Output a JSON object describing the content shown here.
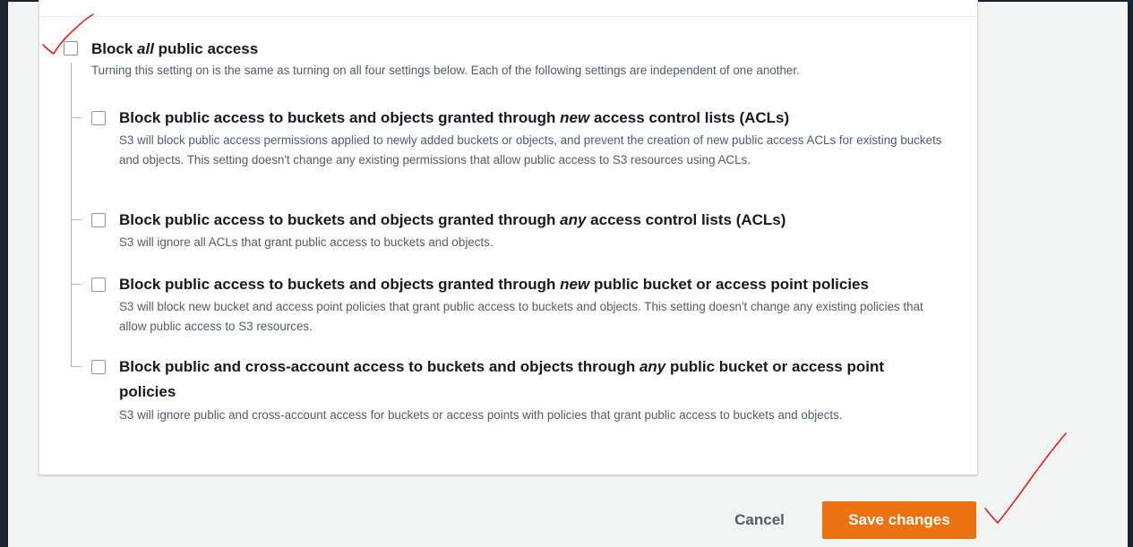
{
  "block_all": {
    "title_before": "Block ",
    "title_em": "all",
    "title_after": " public access",
    "description": "Turning this setting on is the same as turning on all four settings below. Each of the following settings are independent of one another.",
    "checked": false
  },
  "settings": [
    {
      "title_before": "Block public access to buckets and objects granted through ",
      "title_em": "new",
      "title_after": " access control lists (ACLs)",
      "description": "S3 will block public access permissions applied to newly added buckets or objects, and prevent the creation of new public access ACLs for existing buckets and objects. This setting doesn't change any existing permissions that allow public access to S3 resources using ACLs.",
      "checked": false
    },
    {
      "title_before": "Block public access to buckets and objects granted through ",
      "title_em": "any",
      "title_after": " access control lists (ACLs)",
      "description": "S3 will ignore all ACLs that grant public access to buckets and objects.",
      "checked": false
    },
    {
      "title_before": "Block public access to buckets and objects granted through ",
      "title_em": "new",
      "title_after": " public bucket or access point policies",
      "description": "S3 will block new bucket and access point policies that grant public access to buckets and objects. This setting doesn't change any existing policies that allow public access to S3 resources.",
      "checked": false
    },
    {
      "title_before": "Block public and cross-account access to buckets and objects through ",
      "title_em": "any",
      "title_after": " public bucket or access point policies",
      "description": "S3 will ignore public and cross-account access for buckets or access points with policies that grant public access to buckets and objects.",
      "checked": false
    }
  ],
  "actions": {
    "cancel_label": "Cancel",
    "save_label": "Save changes"
  },
  "colors": {
    "primary_button": "#ec7211",
    "annotation_mark": "#e0201b"
  }
}
